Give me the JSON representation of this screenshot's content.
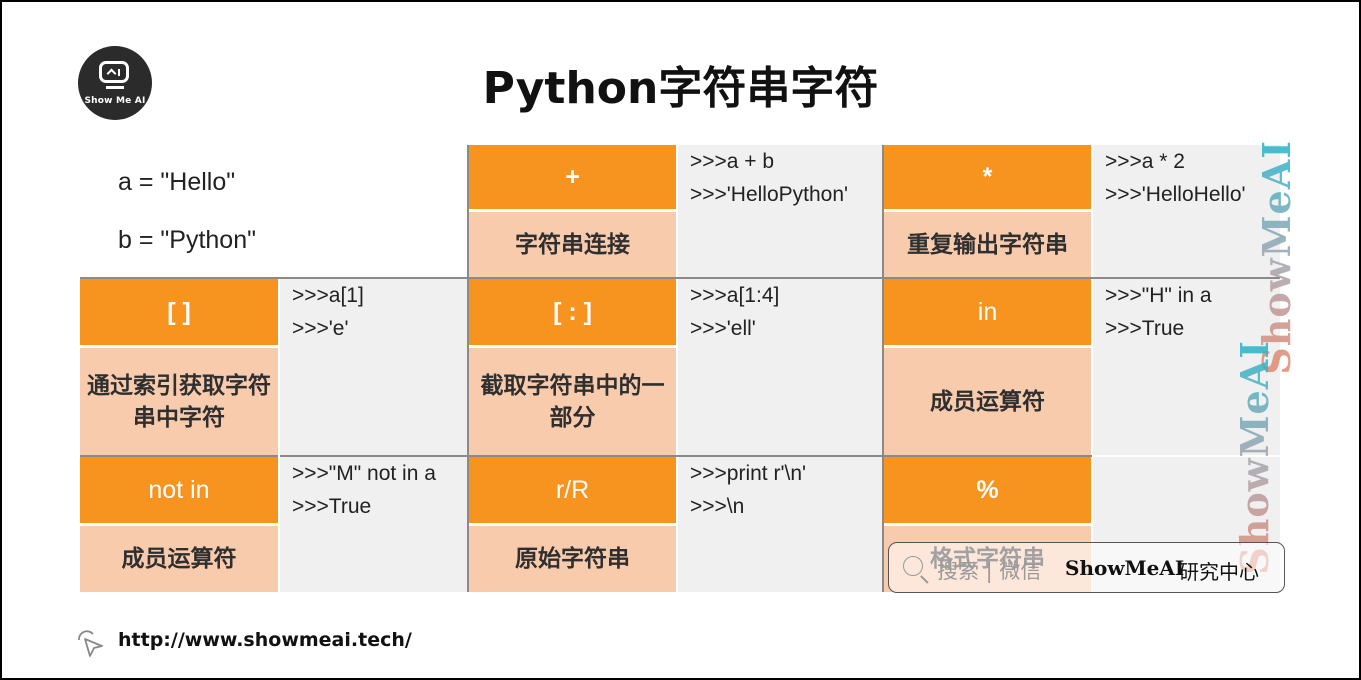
{
  "header": {
    "logo_text": "Show Me AI",
    "title": "Python字符串字符"
  },
  "variables": [
    "a = \"Hello\"",
    "b = \"Python\""
  ],
  "operators": [
    {
      "symbol": "+",
      "description": "字符串连接",
      "code": [
        ">>>a + b",
        ">>>'HelloPython'"
      ]
    },
    {
      "symbol": "*",
      "description": "重复输出字符串",
      "code": [
        ">>>a * 2",
        ">>>'HelloHello'"
      ]
    },
    {
      "symbol": "[ ]",
      "description": "通过索引获取字符串中字符",
      "code": [
        ">>>a[1]",
        ">>>'e'"
      ]
    },
    {
      "symbol": "[ : ]",
      "description": "截取字符串中的一部分",
      "code": [
        ">>>a[1:4]",
        ">>>'ell'"
      ]
    },
    {
      "symbol": "in",
      "description": "成员运算符",
      "code": [
        ">>>\"H\" in a",
        ">>>True"
      ]
    },
    {
      "symbol": "not in",
      "description": "成员运算符",
      "code": [
        ">>>\"M\" not in a",
        ">>>True"
      ]
    },
    {
      "symbol": "r/R",
      "description": "原始字符串",
      "code": [
        ">>>print r'\\n'",
        ">>>\\n"
      ]
    },
    {
      "symbol": "%",
      "description": "格式字符串",
      "code": []
    }
  ],
  "watermark": {
    "text_1": "ShowMeAI",
    "text_2": "ShowMeAI"
  },
  "search_badge": {
    "hint": "搜索 | 微信",
    "brand": "ShowMeAI",
    "center": "研究中心"
  },
  "footer": {
    "link": "http://www.showmeai.tech/"
  },
  "colors": {
    "operator_bg": "#f79420",
    "description_bg": "#f8cbad",
    "code_bg": "#f0f0f0"
  }
}
